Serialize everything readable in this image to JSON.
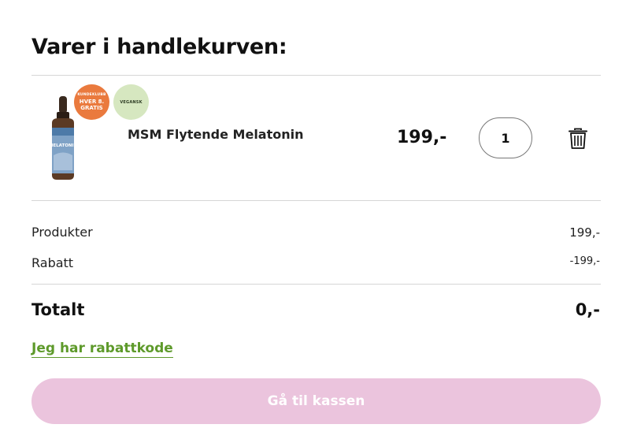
{
  "cart": {
    "title": "Varer i handlekurven:"
  },
  "item": {
    "name": "MSM Flytende Melatonin",
    "price": "199,-",
    "quantity": "1",
    "image_label": "MELATONIN",
    "badges": {
      "club_small": "KUNDEKLUBB",
      "club_main": "HVER 8.",
      "club_sub": "GRATIS",
      "vegan": "VEGANSK"
    }
  },
  "summary": {
    "products_label": "Produkter",
    "products_value": "199,-",
    "discount_label": "Rabatt",
    "discount_value": "-199,-",
    "total_label": "Totalt",
    "total_value": "0,-"
  },
  "actions": {
    "discount_code_link": "Jeg har rabattkode",
    "checkout_button": "Gå til kassen"
  },
  "colors": {
    "accent_green": "#5e9a2b",
    "checkout_pink": "#ebc4dd",
    "badge_orange": "#ea7a3e",
    "badge_green": "#d6e7c0"
  }
}
